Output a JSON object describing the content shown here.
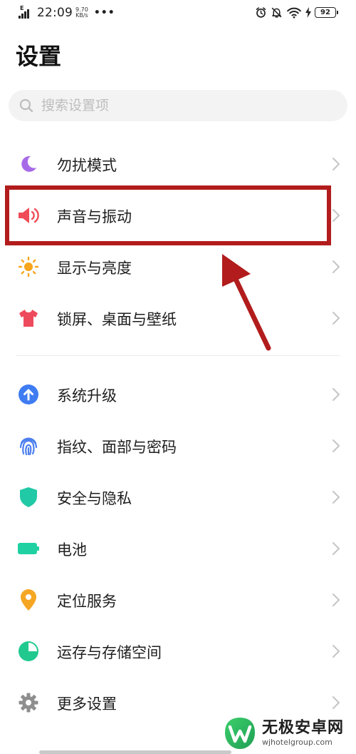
{
  "status_bar": {
    "signal_type": "E",
    "time": "22:09",
    "net_speed_value": "9.70",
    "net_speed_unit": "KB/s",
    "overflow": "•••",
    "battery_level": "92"
  },
  "header": {
    "title": "设置"
  },
  "search": {
    "placeholder": "搜索设置项"
  },
  "settings": {
    "items": [
      {
        "label": "勿扰模式",
        "icon": "moon-icon",
        "color": "#a86be8"
      },
      {
        "label": "声音与振动",
        "icon": "speaker-icon",
        "color": "#f04b57"
      },
      {
        "label": "显示与亮度",
        "icon": "sun-icon",
        "color": "#f7a51c"
      },
      {
        "label": "锁屏、桌面与壁纸",
        "icon": "tshirt-icon",
        "color": "#ee4a5d"
      },
      {
        "label": "系统升级",
        "icon": "upgrade-arrow-icon",
        "color": "#3f7cf2"
      },
      {
        "label": "指纹、面部与密码",
        "icon": "fingerprint-icon",
        "color": "#4d7ff0"
      },
      {
        "label": "安全与隐私",
        "icon": "shield-icon",
        "color": "#21c9a6"
      },
      {
        "label": "电池",
        "icon": "battery-icon",
        "color": "#1fd1a2"
      },
      {
        "label": "定位服务",
        "icon": "location-pin-icon",
        "color": "#f5a623"
      },
      {
        "label": "运存与存储空间",
        "icon": "pie-chart-icon",
        "color": "#21c98f"
      },
      {
        "label": "更多设置",
        "icon": "gear-icon",
        "color": "#8e8e8e"
      }
    ]
  },
  "annotation": {
    "highlight_color": "#b21c1c",
    "highlighted_item": "声音与振动"
  },
  "watermark": {
    "name": "无极安卓网",
    "url": "wjhotelgroup.com"
  }
}
